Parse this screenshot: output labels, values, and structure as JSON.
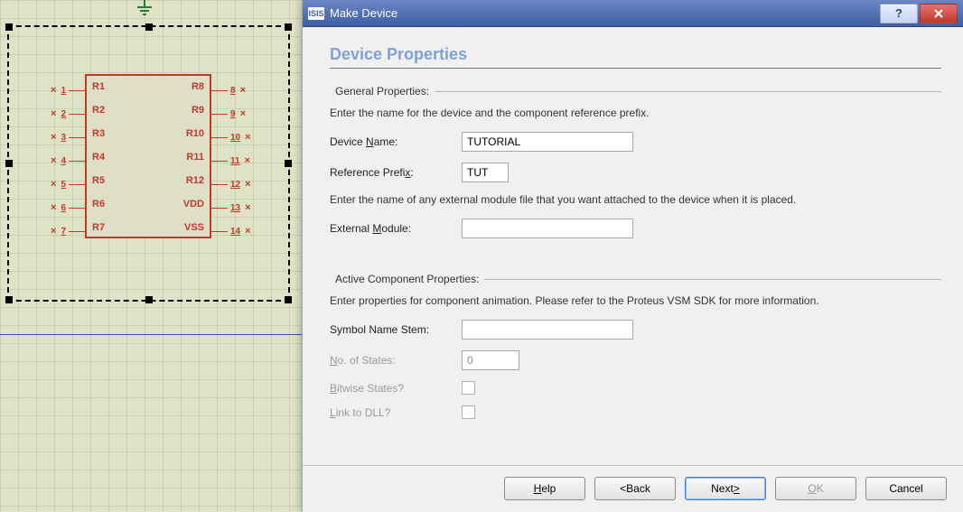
{
  "canvas": {
    "chip": {
      "left_pins": [
        {
          "n": "1",
          "name": "R1"
        },
        {
          "n": "2",
          "name": "R2"
        },
        {
          "n": "3",
          "name": "R3"
        },
        {
          "n": "4",
          "name": "R4"
        },
        {
          "n": "5",
          "name": "R5"
        },
        {
          "n": "6",
          "name": "R6"
        },
        {
          "n": "7",
          "name": "R7"
        }
      ],
      "right_pins": [
        {
          "n": "8",
          "name": "R8"
        },
        {
          "n": "9",
          "name": "R9"
        },
        {
          "n": "10",
          "name": "R10"
        },
        {
          "n": "11",
          "name": "R11"
        },
        {
          "n": "12",
          "name": "R12"
        },
        {
          "n": "13",
          "name": "VDD"
        },
        {
          "n": "14",
          "name": "VSS"
        }
      ]
    }
  },
  "dialog": {
    "app_icon": "ISIS",
    "title": "Make Device",
    "heading": "Device Properties",
    "general": {
      "legend": "General Properties:",
      "helper": "Enter the name for the device and the component reference prefix.",
      "device_name_label": "Device Name:",
      "device_name_value": "TUTORIAL",
      "ref_prefix_label": "Reference Prefix:",
      "ref_prefix_value": "TUT",
      "ext_helper": "Enter the name of any external module file that you want attached to the device when it is placed.",
      "ext_module_label": "External Module:",
      "ext_module_value": ""
    },
    "active": {
      "legend": "Active Component Properties:",
      "helper": "Enter properties for component animation. Please refer to the Proteus VSM SDK for more information.",
      "symbol_label": "Symbol Name Stem:",
      "symbol_value": "",
      "states_label": "No. of States:",
      "states_value": "0",
      "bitwise_label": "Bitwise States?",
      "link_label": "Link to DLL?"
    },
    "buttons": {
      "help": "Help",
      "back": "<Back",
      "next": "Next>",
      "ok": "OK",
      "cancel": "Cancel"
    }
  }
}
